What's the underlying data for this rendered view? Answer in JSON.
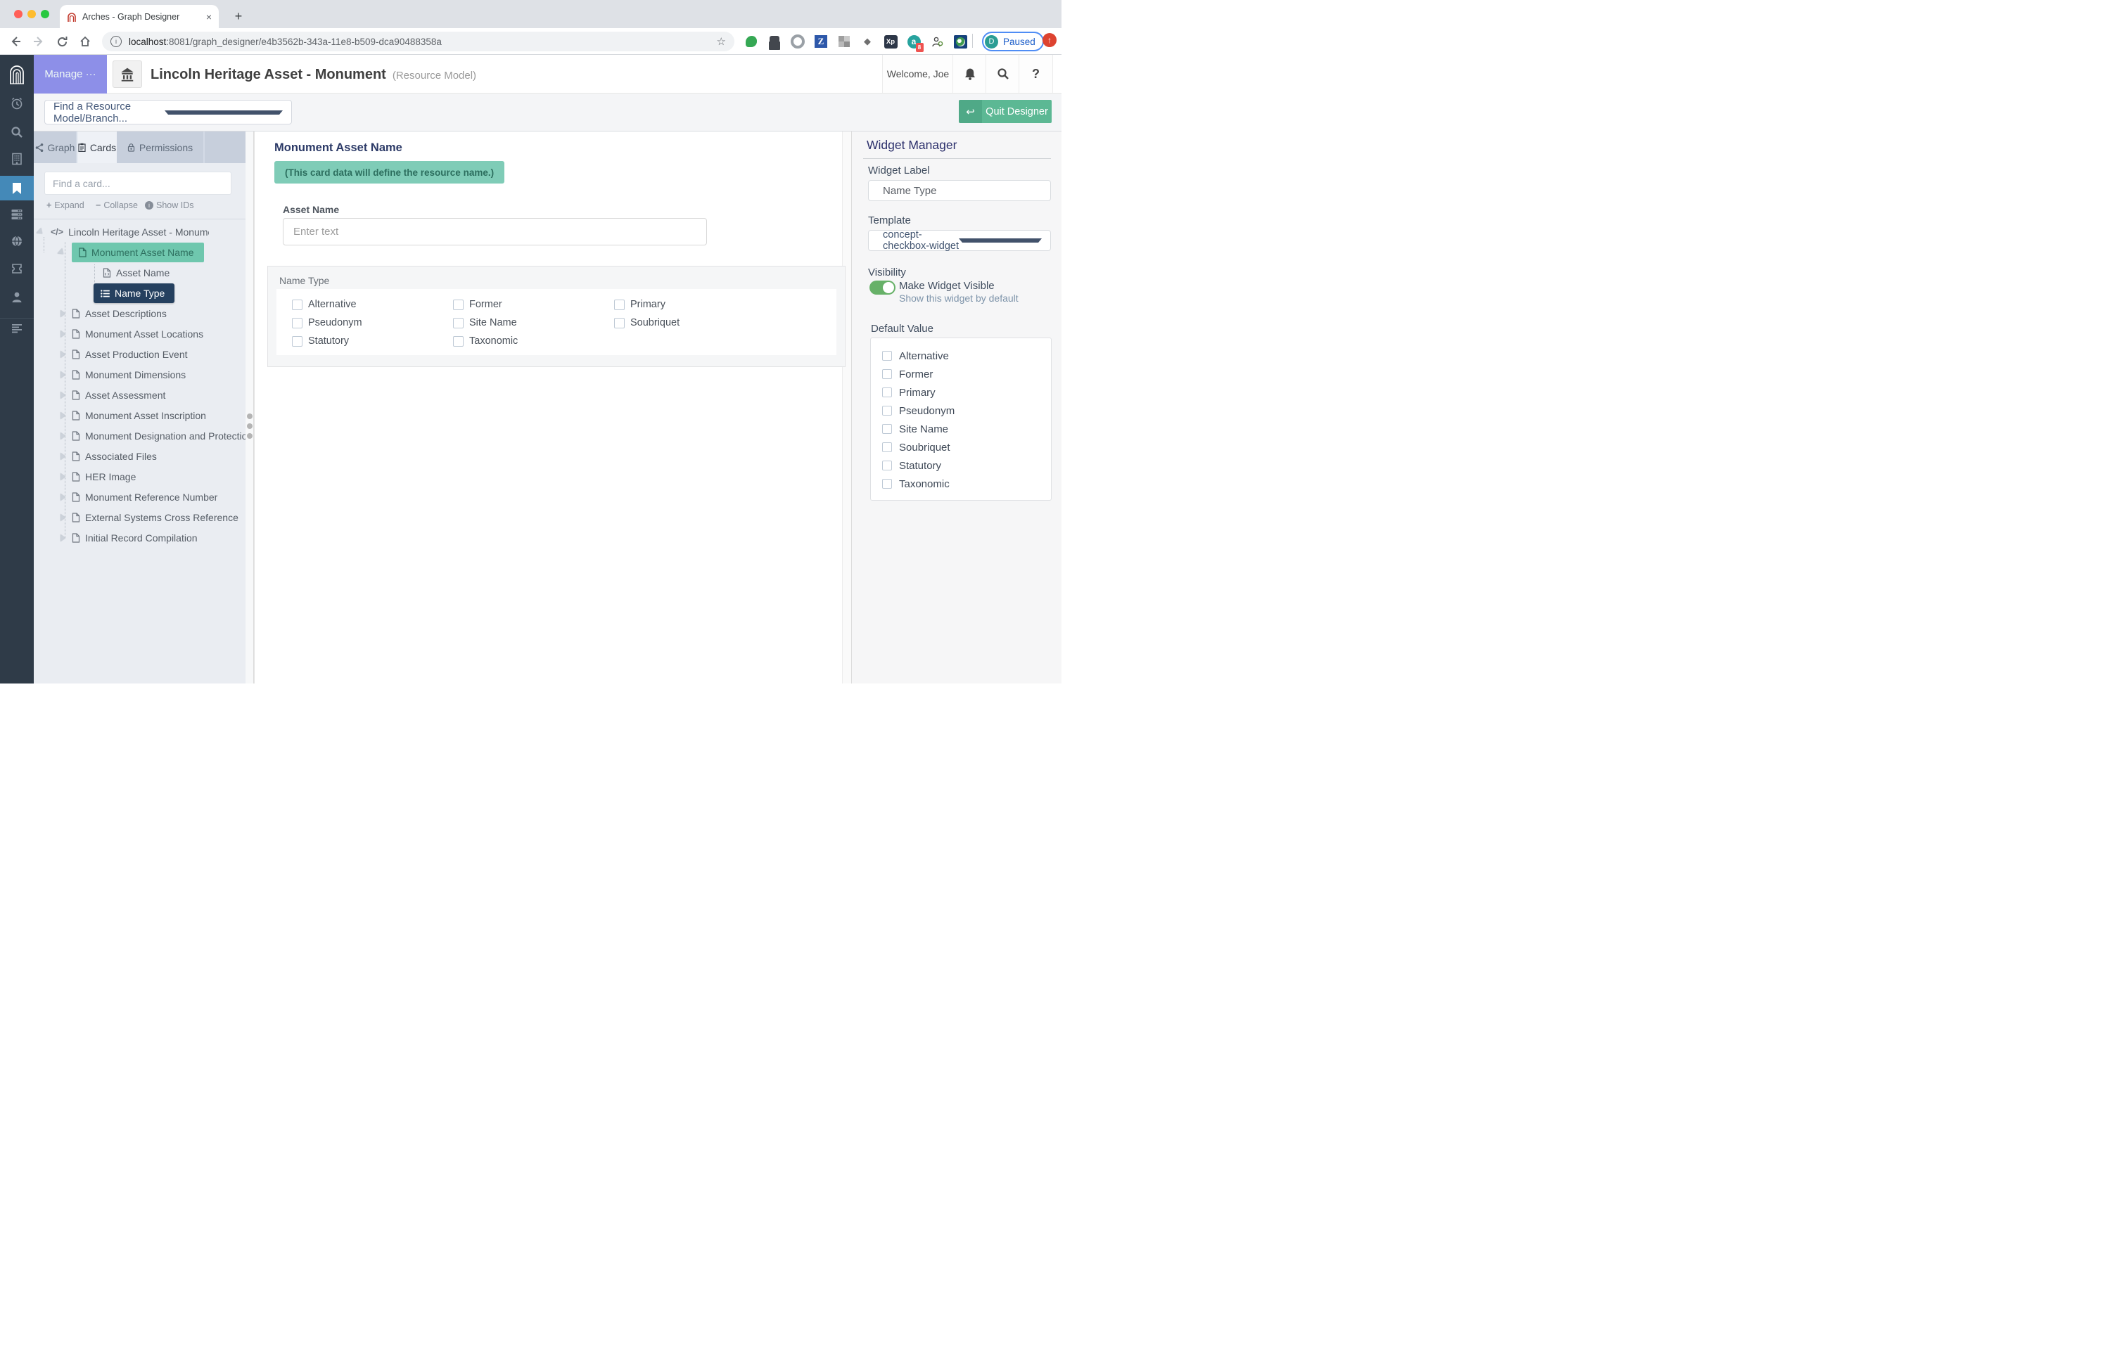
{
  "browser": {
    "tab_title": "Arches - Graph Designer",
    "url": {
      "host": "localhost",
      "path": ":8081/graph_designer/e4b3562b-343a-11e8-b509-dca90488358a"
    },
    "profile": {
      "initial": "D",
      "status": "Paused"
    },
    "extensions": {
      "zotero": "Z",
      "xp": "Xp",
      "a": "a",
      "a_badge": "8"
    }
  },
  "app_header": {
    "manage_label": "Manage ···",
    "title": "Lincoln Heritage Asset - Monument",
    "subtitle": "(Resource Model)",
    "welcome": "Welcome, Joe",
    "help_label": "?"
  },
  "model_bar": {
    "find_placeholder": "Find a Resource Model/Branch...",
    "quit_label": "Quit Designer"
  },
  "tabs": {
    "graph": "Graph",
    "cards": "Cards",
    "permissions": "Permissions"
  },
  "tree": {
    "search_placeholder": "Find a card...",
    "expand": "Expand",
    "collapse": "Collapse",
    "show_ids": "Show IDs",
    "root_label": "Lincoln Heritage Asset - Monument (edit r",
    "card_label": "Monument Asset Name",
    "children": [
      "Asset Name",
      "Name Type"
    ],
    "cards": [
      "Asset Descriptions",
      "Monument Asset Locations",
      "Asset Production Event",
      "Monument Dimensions",
      "Asset Assessment",
      "Monument Asset Inscription",
      "Monument Designation and Protectio",
      "Associated Files",
      "HER Image",
      "Monument Reference Number",
      "External Systems Cross Reference",
      "Initial Record Compilation"
    ]
  },
  "card_form": {
    "title": "Monument Asset Name",
    "note": "(This card data will define the resource name.)",
    "asset_name_label": "Asset Name",
    "asset_name_placeholder": "Enter text",
    "name_type_label": "Name Type",
    "options": [
      "Alternative",
      "Former",
      "Primary",
      "Pseudonym",
      "Site Name",
      "Soubriquet",
      "Statutory",
      "Taxonomic"
    ]
  },
  "widget_manager": {
    "title": "Widget Manager",
    "widget_label": {
      "label": "Widget Label",
      "value": "Name Type"
    },
    "template": {
      "label": "Template",
      "value": "concept-checkbox-widget"
    },
    "visibility": {
      "label": "Visibility",
      "toggle_label": "Make Widget Visible",
      "toggle_sub": "Show this widget by default"
    },
    "default_value": {
      "label": "Default Value",
      "options": [
        "Alternative",
        "Former",
        "Primary",
        "Pseudonym",
        "Site Name",
        "Soubriquet",
        "Statutory",
        "Taxonomic"
      ]
    }
  },
  "colors": {
    "accent_teal": "#5cb894",
    "selected_teal": "#6fc7ae",
    "note_teal": "#7fccb7",
    "selected_navy": "#25405f",
    "manage_purple": "#8d8fe8",
    "sidebar_dark": "#2f3b48",
    "active_rail_blue": "#4489b8",
    "toggle_green": "#67b168",
    "heading_navy": "#2c3a67"
  }
}
